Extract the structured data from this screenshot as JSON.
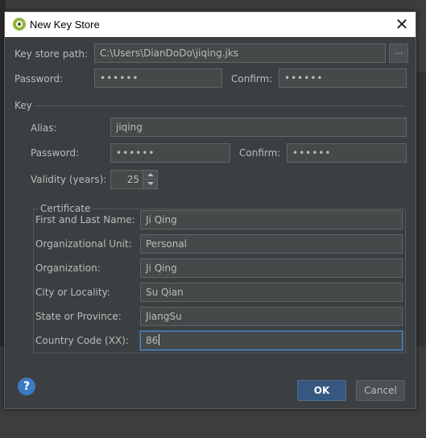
{
  "dialog": {
    "title": "New Key Store",
    "close_glyph": "✕",
    "app_icon": "android-studio-icon"
  },
  "keystore": {
    "path_label": "Key store path:",
    "path_value": "C:\\Users\\DianDoDo\\jiqing.jks",
    "browse_label": "...",
    "password_label": "Password:",
    "password_value": "••••••",
    "confirm_label": "Confirm:",
    "confirm_value": "••••••"
  },
  "key": {
    "section_label": "Key",
    "alias_label": "Alias:",
    "alias_value": "jiqing",
    "password_label": "Password:",
    "password_value": "••••••",
    "confirm_label": "Confirm:",
    "confirm_value": "••••••",
    "validity_label": "Validity (years):",
    "validity_value": "25"
  },
  "certificate": {
    "section_label": "Certificate",
    "first_last_label": "First and Last Name:",
    "first_last_value": "Ji Qing",
    "org_unit_label": "Organizational Unit:",
    "org_unit_value": "Personal",
    "organization_label": "Organization:",
    "organization_value": "Ji Qing",
    "city_label": "City or Locality:",
    "city_value": "Su Qian",
    "state_label": "State or Province:",
    "state_value": "JiangSu",
    "country_label": "Country Code (XX):",
    "country_value": "86"
  },
  "buttons": {
    "help": "?",
    "ok": "OK",
    "cancel": "Cancel"
  },
  "colors": {
    "dialog_bg": "#3c3f41",
    "field_bg": "#45494a",
    "focus_border": "#4a88c7",
    "ok_bg": "#365880",
    "help_bg": "#3d7ac4"
  }
}
